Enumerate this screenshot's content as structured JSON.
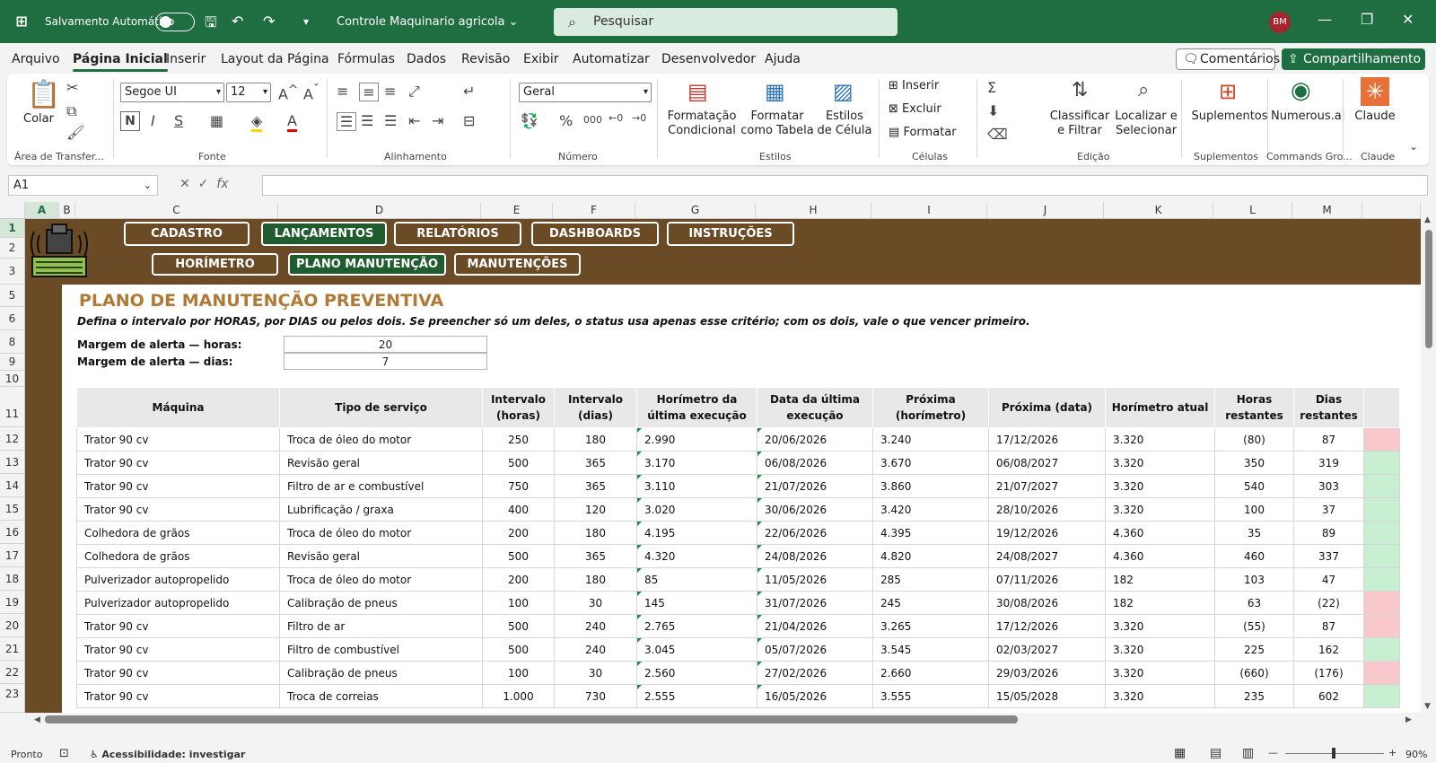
{
  "titlebar": {
    "autosave_label": "Salvamento Automático",
    "doc_title": "Controle Maquinario agricola",
    "search_placeholder": "Pesquisar",
    "avatar_initials": "BM"
  },
  "menu": {
    "items": [
      "Arquivo",
      "Página Inicial",
      "Inserir",
      "Layout da Página",
      "Fórmulas",
      "Dados",
      "Revisão",
      "Exibir",
      "Automatizar",
      "Desenvolvedor",
      "Ajuda"
    ],
    "active_index": 1,
    "comments_label": "Comentários",
    "share_label": "Compartilhamento"
  },
  "ribbon": {
    "paste_label": "Colar",
    "font_name": "Segoe UI",
    "font_size": "12",
    "number_format": "Geral",
    "cond_format": "Formatação Condicional",
    "format_table": "Formatar como Tabela",
    "cell_styles": "Estilos de Célula",
    "insert": "Inserir",
    "delete": "Excluir",
    "format": "Formatar",
    "sort_filter": "Classificar e Filtrar",
    "find_select": "Localizar e Selecionar",
    "addins": "Suplementos",
    "numerous": "Numerous.ai",
    "claude": "Claude",
    "groups": {
      "clipboard": "Área de Transfer...",
      "font": "Fonte",
      "alignment": "Alinhamento",
      "number": "Número",
      "styles": "Estilos",
      "cells": "Células",
      "editing": "Edição",
      "addins": "Suplementos",
      "commands": "Commands Gro...",
      "claude": "Claude"
    }
  },
  "formula_bar": {
    "name_box": "A1",
    "fx": "fx",
    "content": ""
  },
  "columns": [
    "A",
    "B",
    "C",
    "D",
    "E",
    "F",
    "G",
    "H",
    "I",
    "J",
    "K",
    "L",
    "M"
  ],
  "rows": [
    "1",
    "2",
    "3",
    "5",
    "6",
    "8",
    "9",
    "10",
    "11",
    "12",
    "13",
    "14",
    "15",
    "16",
    "17",
    "18",
    "19",
    "20",
    "21",
    "22",
    "23"
  ],
  "nav": {
    "top": [
      "CADASTRO",
      "LANÇAMENTOS",
      "RELATÓRIOS",
      "DASHBOARDS",
      "INSTRUÇÕES"
    ],
    "top_active": 1,
    "bottom": [
      "HORÍMETRO",
      "PLANO MANUTENÇÃO",
      "MANUTENÇÕES"
    ],
    "bottom_active": 1
  },
  "page": {
    "title": "PLANO DE MANUTENÇÃO PREVENTIVA",
    "subtitle": "Defina o intervalo por HORAS, por DIAS ou pelos dois. Se preencher só um deles, o status usa apenas esse critério; com os dois, vale o que vencer primeiro.",
    "margin_hours_label": "Margem de alerta — horas:",
    "margin_hours_value": "20",
    "margin_days_label": "Margem de alerta — dias:",
    "margin_days_value": "7"
  },
  "table": {
    "headers": [
      "Máquina",
      "Tipo de serviço",
      "Intervalo (horas)",
      "Intervalo (dias)",
      "Horímetro da última execução",
      "Data da última execução",
      "Próxima (horímetro)",
      "Próxima (data)",
      "Horímetro atual",
      "Horas restantes",
      "Dias restantes"
    ],
    "rows": [
      {
        "cells": [
          "Trator 90 cv",
          "Troca de óleo do motor",
          "250",
          "180",
          "2.990",
          "20/06/2026",
          "3.240",
          "17/12/2026",
          "3.320",
          "(80)",
          "87"
        ],
        "status": "red"
      },
      {
        "cells": [
          "Trator 90 cv",
          "Revisão geral",
          "500",
          "365",
          "3.170",
          "06/08/2026",
          "3.670",
          "06/08/2027",
          "3.320",
          "350",
          "319"
        ],
        "status": "green"
      },
      {
        "cells": [
          "Trator 90 cv",
          "Filtro de ar e combustível",
          "750",
          "365",
          "3.110",
          "21/07/2026",
          "3.860",
          "21/07/2027",
          "3.320",
          "540",
          "303"
        ],
        "status": "green"
      },
      {
        "cells": [
          "Trator 90 cv",
          "Lubrificação / graxa",
          "400",
          "120",
          "3.020",
          "30/06/2026",
          "3.420",
          "28/10/2026",
          "3.320",
          "100",
          "37"
        ],
        "status": "green"
      },
      {
        "cells": [
          "Colhedora de grãos",
          "Troca de óleo do motor",
          "200",
          "180",
          "4.195",
          "22/06/2026",
          "4.395",
          "19/12/2026",
          "4.360",
          "35",
          "89"
        ],
        "status": "green"
      },
      {
        "cells": [
          "Colhedora de grãos",
          "Revisão geral",
          "500",
          "365",
          "4.320",
          "24/08/2026",
          "4.820",
          "24/08/2027",
          "4.360",
          "460",
          "337"
        ],
        "status": "green"
      },
      {
        "cells": [
          "Pulverizador autopropelido",
          "Troca de óleo do motor",
          "200",
          "180",
          "85",
          "11/05/2026",
          "285",
          "07/11/2026",
          "182",
          "103",
          "47"
        ],
        "status": "green"
      },
      {
        "cells": [
          "Pulverizador autopropelido",
          "Calibração de pneus",
          "100",
          "30",
          "145",
          "31/07/2026",
          "245",
          "30/08/2026",
          "182",
          "63",
          "(22)"
        ],
        "status": "red"
      },
      {
        "cells": [
          "Trator 90 cv",
          "Filtro de ar",
          "500",
          "240",
          "2.765",
          "21/04/2026",
          "3.265",
          "17/12/2026",
          "3.320",
          "(55)",
          "87"
        ],
        "status": "red"
      },
      {
        "cells": [
          "Trator 90 cv",
          "Filtro de combustível",
          "500",
          "240",
          "3.045",
          "05/07/2026",
          "3.545",
          "02/03/2027",
          "3.320",
          "225",
          "162"
        ],
        "status": "green"
      },
      {
        "cells": [
          "Trator 90 cv",
          "Calibração de pneus",
          "100",
          "30",
          "2.560",
          "27/02/2026",
          "2.660",
          "29/03/2026",
          "3.320",
          "(660)",
          "(176)"
        ],
        "status": "red"
      },
      {
        "cells": [
          "Trator 90 cv",
          "Troca de correias",
          "1.000",
          "730",
          "2.555",
          "16/05/2026",
          "3.555",
          "15/05/2028",
          "3.320",
          "235",
          "602"
        ],
        "status": "green"
      }
    ]
  },
  "statusbar": {
    "ready": "Pronto",
    "accessibility": "Acessibilidade: investigar",
    "zoom": "90%"
  },
  "colors": {
    "excel_green": "#1e6e42",
    "banner_brown": "#6b4a26",
    "active_nav": "#1f5c2e",
    "title_gold": "#b07a36",
    "status_red": "#f9c8cc",
    "status_green": "#c9efd3"
  }
}
